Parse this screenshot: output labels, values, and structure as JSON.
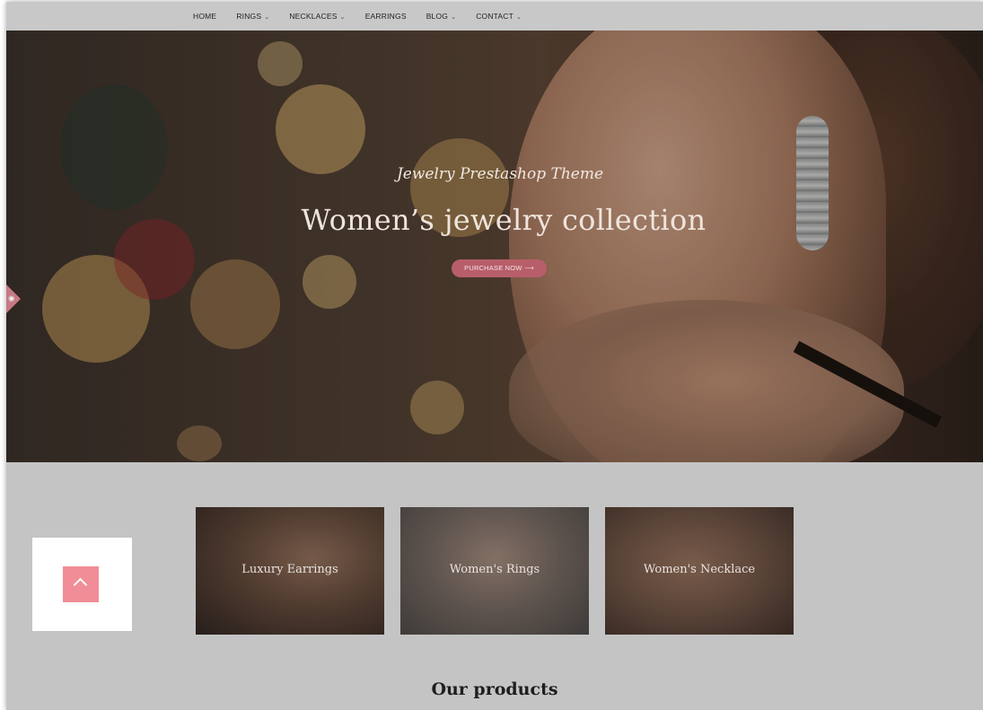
{
  "nav": {
    "items": [
      {
        "label": "HOME",
        "has_dropdown": false
      },
      {
        "label": "RINGS",
        "has_dropdown": true
      },
      {
        "label": "NECKLACES",
        "has_dropdown": true
      },
      {
        "label": "EARRINGS",
        "has_dropdown": false
      },
      {
        "label": "BLOG",
        "has_dropdown": true
      },
      {
        "label": "CONTACT",
        "has_dropdown": true
      }
    ],
    "caret_glyph": "⌄"
  },
  "hero": {
    "subtitle": "Jewelry Prestashop Theme",
    "title": "Women’s jewelry collection",
    "cta_label": "PURCHASE NOW ⟶"
  },
  "categories": [
    {
      "label": "Luxury Earrings"
    },
    {
      "label": "Women's Rings"
    },
    {
      "label": "Women's Necklace"
    }
  ],
  "products": {
    "title": "Our products"
  },
  "icons": {
    "side_tab": "gear-icon",
    "scroll_top": "chevron-up-icon"
  },
  "colors": {
    "accent": "#f08d96",
    "cta": "#b85e6a"
  }
}
